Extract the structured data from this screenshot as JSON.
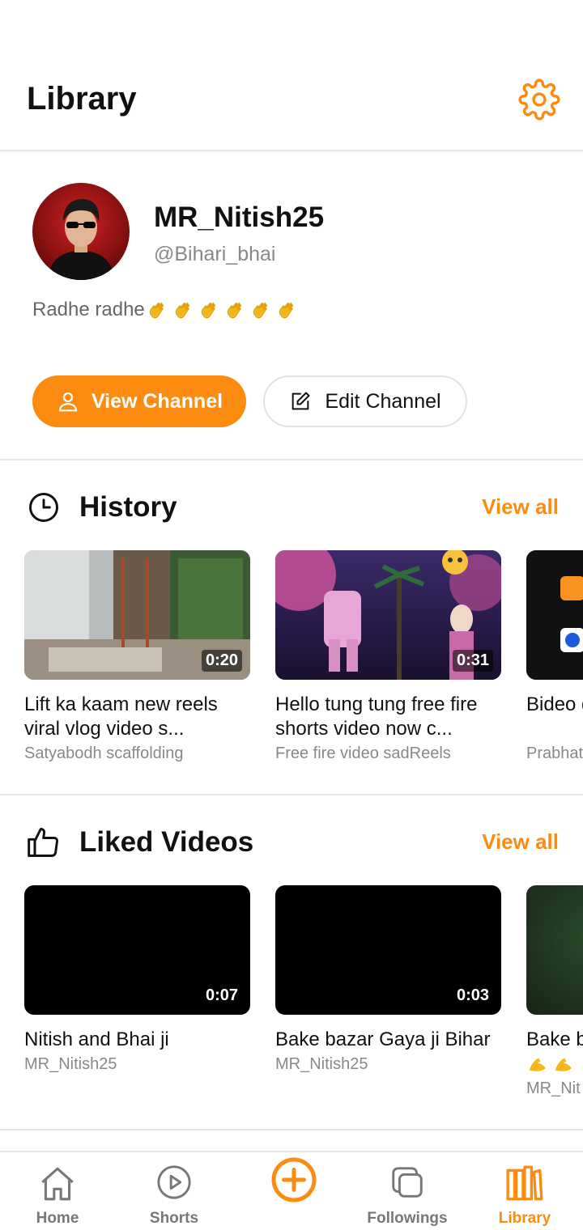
{
  "header": {
    "title": "Library",
    "settings_icon": "gear-icon"
  },
  "profile": {
    "name": "MR_Nitish25",
    "handle": "@Bihari_bhai",
    "bio": "Radhe radhe",
    "bio_emoji_count": 6,
    "view_channel_label": "View Channel",
    "edit_channel_label": "Edit Channel"
  },
  "history": {
    "title": "History",
    "view_all": "View all",
    "items": [
      {
        "title": "Lift ka kaam new reels viral vlog video s...",
        "channel": "Satyabodh scaffolding",
        "duration": "0:20"
      },
      {
        "title": "Hello tung tung free fire shorts video now c...",
        "channel": "Free fire video sadReels",
        "duration": "0:31"
      },
      {
        "title": "Bideo downl",
        "channel": "Prabhat",
        "duration": ""
      }
    ]
  },
  "liked": {
    "title": "Liked Videos",
    "view_all": "View all",
    "items": [
      {
        "title": "Nitish and Bhai ji",
        "channel": "MR_Nitish25",
        "duration": "0:07"
      },
      {
        "title": "Bake bazar Gaya ji Bihar",
        "channel": "MR_Nitish25",
        "duration": "0:03"
      },
      {
        "title": "Bake b",
        "channel": "MR_Nit",
        "duration": ""
      }
    ]
  },
  "nav": {
    "home": "Home",
    "shorts": "Shorts",
    "followings": "Followings",
    "library": "Library",
    "active": "library"
  },
  "colors": {
    "accent": "#fb8c11",
    "text": "#111111",
    "muted": "#888888",
    "divider": "#e6e6e6"
  }
}
